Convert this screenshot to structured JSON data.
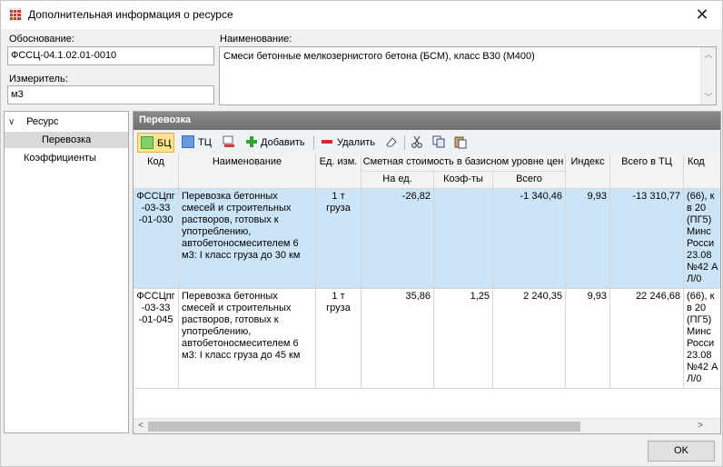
{
  "window": {
    "title": "Дополнительная информация о ресурсе",
    "close_glyph": "✕"
  },
  "form": {
    "basis_label": "Обоснование:",
    "basis_value": "ФССЦ-04.1.02.01-0010",
    "unit_label": "Измеритель:",
    "unit_value": "м3",
    "name_label": "Наименование:",
    "name_value": "Смеси бетонные мелкозернистого бетона (БСМ), класс В30 (М400)"
  },
  "tree": {
    "items": [
      {
        "label": "Ресурс"
      },
      {
        "label": "Перевозка"
      },
      {
        "label": "Коэффициенты"
      }
    ]
  },
  "panel": {
    "header": "Перевозка",
    "toolbar": {
      "bc": "БЦ",
      "tc": "ТЦ",
      "add": "Добавить",
      "delete": "Удалить"
    },
    "columns": {
      "code": "Код",
      "name": "Наименование",
      "unit": "Ед. изм.",
      "cost_group": "Сметная стоимость в базисном уровне цен",
      "per_unit": "На ед.",
      "coef": "Коэф-ты",
      "total": "Всего",
      "index": "Индекс",
      "total_tc": "Всего в ТЦ",
      "code2": "Код"
    },
    "rows": [
      {
        "code": "ФССЦпг -03-33 -01-030",
        "name": "Перевозка бетонных смесей и строительных растворов, готовых к употреблению, автобетоносмесителем 6 м3: I класс груза до 30 км",
        "unit": "1 т груза",
        "per_unit": "-26,82",
        "coef": "",
        "total": "-1 340,46",
        "index": "9,93",
        "total_tc": "-13 310,77",
        "code2": "(66), кв 20 (ПГ5) Минс Росси 23.08 №42 АЛ/0"
      },
      {
        "code": "ФССЦпг -03-33 -01-045",
        "name": "Перевозка бетонных смесей и строительных растворов, готовых к употреблению, автобетоносмесителем 6 м3: I класс груза до 45 км",
        "unit": "1 т груза",
        "per_unit": "35,86",
        "coef": "1,25",
        "total": "2 240,35",
        "index": "9,93",
        "total_tc": "22 246,68",
        "code2": "(66), кв 20 (ПГ5) Минс Росси 23.08 №42 АЛ/0"
      }
    ]
  },
  "footer": {
    "ok": "OK"
  },
  "colors": {
    "selected_row": "#cce4f7",
    "active_toolbar": "#fde38a",
    "panel_header": "#7a7a7a"
  }
}
